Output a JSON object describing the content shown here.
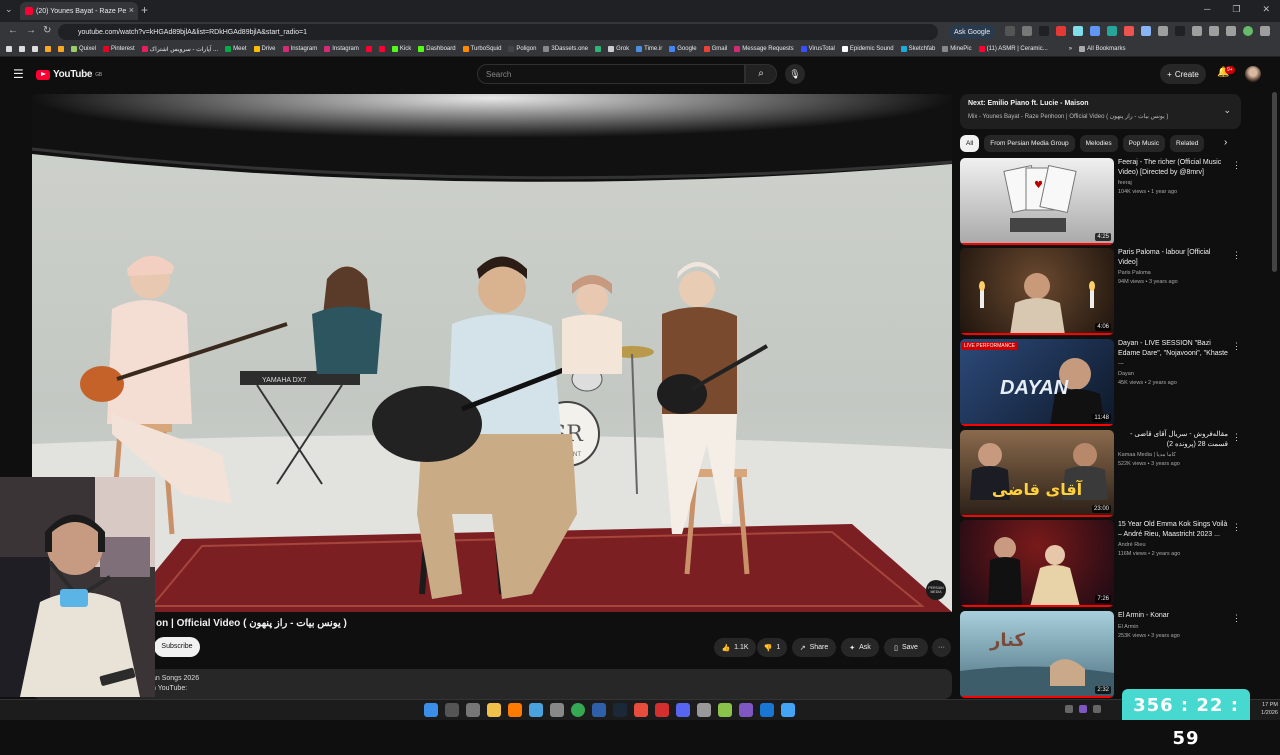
{
  "browser": {
    "tab_title": "(20) Younes Bayat - Raze Pe",
    "url": "youtube.com/watch?v=kHGAd89bjlA&list=RDkHGAd89bjlA&start_radio=1",
    "ask_google": "Ask Google",
    "all_bookmarks": "All Bookmarks"
  },
  "bookmarks": [
    {
      "label": "Quixel",
      "color": "#9ccc65"
    },
    {
      "label": "Pinterest",
      "color": "#e60023"
    },
    {
      "label": "آپارات - سرویس اشتراک ...",
      "color": "#ea1d5d"
    },
    {
      "label": "Meet",
      "color": "#00ac47"
    },
    {
      "label": "Drive",
      "color": "#fbbc04"
    },
    {
      "label": "Instagram",
      "color": "#d62976"
    },
    {
      "label": "Instagram",
      "color": "#d62976"
    },
    {
      "label": "",
      "color": "#ff0033"
    },
    {
      "label": "",
      "color": "#ff0033"
    },
    {
      "label": "Kick",
      "color": "#53fc18"
    },
    {
      "label": "Dashboard",
      "color": "#53fc18"
    },
    {
      "label": "TurboSquid",
      "color": "#ff8a00"
    },
    {
      "label": "Poligon",
      "color": "#444444"
    },
    {
      "label": "3Dassets.one",
      "color": "#888888"
    },
    {
      "label": "",
      "color": "#2bb673"
    },
    {
      "label": "Grok",
      "color": "#cccccc"
    },
    {
      "label": "Time.ir",
      "color": "#4a90e2"
    },
    {
      "label": "Google",
      "color": "#4285f4"
    },
    {
      "label": "Gmail",
      "color": "#ea4335"
    },
    {
      "label": "Message Requests",
      "color": "#d62976"
    },
    {
      "label": "VirusTotal",
      "color": "#394eff"
    },
    {
      "label": "Epidemic Sound",
      "color": "#ffffff"
    },
    {
      "label": "Sketchfab",
      "color": "#1caad9"
    },
    {
      "label": "MinePic",
      "color": "#888888"
    },
    {
      "label": "(11) ASMR | Ceramic...",
      "color": "#ff0033"
    }
  ],
  "youtube": {
    "logo_text": "YouTube",
    "logo_region": "GB",
    "search_placeholder": "Search",
    "create_label": "Create",
    "notif_count": "9+"
  },
  "video": {
    "title_visible": "on | Official Video ( یونس بیات - راز پنهون )",
    "subscribe_label": "Subscribe",
    "likes": "1.1K",
    "dislikes": "1",
    "share_label": "Share",
    "ask_label": "Ask",
    "save_label": "Save",
    "desc_line1": "an Songs 2026",
    "desc_line2": "n YouTube:",
    "watermark": "PERSIAN MEDIA",
    "keyboard_brand": "YAMAHA DX7",
    "drum_brand": "SAZRENT"
  },
  "up_next": {
    "title": "Next: Emilio Piano ft. Lucie - Maison",
    "subtitle": "Mix - Younes Bayat - Raze Penhoon | Official Video ( یونس بیات - راز پنهون )"
  },
  "chips": [
    "All",
    "From Persian Media Group",
    "Melodies",
    "Pop Music",
    "Related"
  ],
  "recommendations": [
    {
      "title": "Feeraj - The richer (Official Music Video) [Directed by @8mrv]",
      "channel": "feeraj",
      "meta": "104K views • 1 year ago",
      "duration": "4:25",
      "thumb": [
        "#f0f0f0",
        "#a8a8a8"
      ],
      "progress": 1.0
    },
    {
      "title": "Paris Paloma - labour [Official Video]",
      "channel": "Paris Paloma",
      "meta": "94M views • 3 years ago",
      "duration": "4:06",
      "thumb": [
        "#6b4a2f",
        "#1e140e"
      ],
      "progress": 1.0
    },
    {
      "title": "Dayan - LIVE SESSION \"Bazi Edame Dare\", \"Nojavooni\", \"Khaste ...",
      "channel": "Dayan",
      "meta": "45K views • 2 years ago",
      "duration": "11:48",
      "thumb": [
        "#2c4a7a",
        "#0e1828"
      ],
      "progress": 1.0,
      "live_badge": "LIVE PERFORMANCE",
      "overlay_text": "DAYAN"
    },
    {
      "title": "مقاله‌فروش - سریال آقای قاضی - قسمت 28 (پرونده 2)",
      "channel": "Kamaa Media | کاما مدیا",
      "meta": "522K views • 3 years ago",
      "duration": "23:00",
      "thumb": [
        "#8a6a4c",
        "#2a1f17"
      ],
      "progress": 1.0,
      "overlay_text": "آقای قاضی"
    },
    {
      "title": "15 Year Old Emma Kok Sings Voilà – André Rieu, Maastricht 2023 ...",
      "channel": "André Rieu",
      "meta": "116M views • 2 years ago",
      "duration": "7:26",
      "thumb": [
        "#7a1a1a",
        "#1a0a14"
      ],
      "progress": 1.0
    },
    {
      "title": "El Armin - Konar",
      "channel": "El Armin",
      "meta": "253K views • 3 years ago",
      "duration": "2:32",
      "thumb": [
        "#8fb8c9",
        "#4b6f7e"
      ],
      "progress": 1.0,
      "overlay_text": "کنار"
    }
  ],
  "timer": "356 : 22 : 59",
  "clock": {
    "time": "17 PM",
    "date": "1/2026"
  }
}
